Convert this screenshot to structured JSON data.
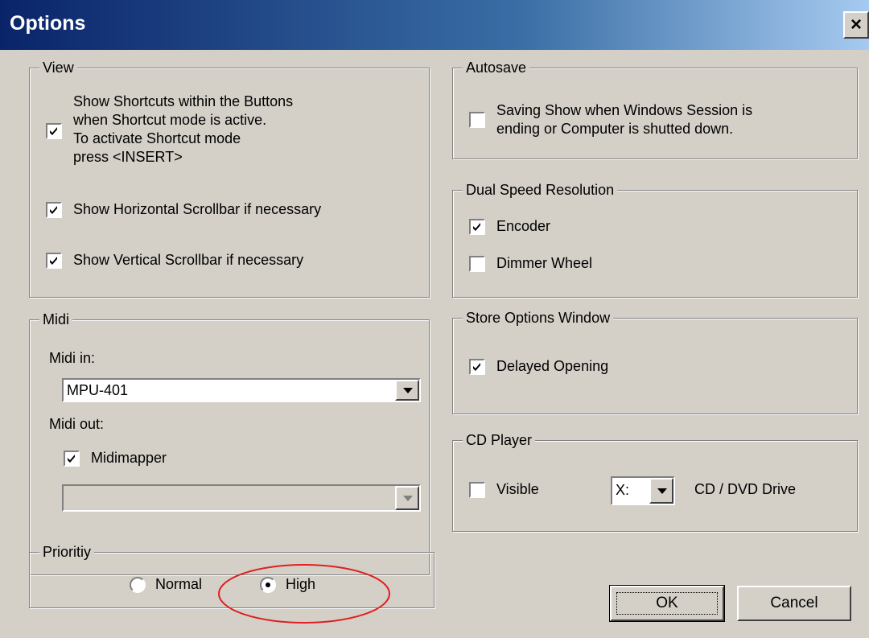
{
  "window": {
    "title": "Options",
    "close_label": "×"
  },
  "view": {
    "legend": "View",
    "shortcuts": {
      "checked": true,
      "lines": [
        "Show Shortcuts within the Buttons",
        "when Shortcut mode is active.",
        "To activate Shortcut mode",
        "press <INSERT>"
      ]
    },
    "horizontal": {
      "checked": true,
      "label": "Show Horizontal Scrollbar if necessary"
    },
    "vertical": {
      "checked": true,
      "label": "Show Vertical Scrollbar if necessary"
    }
  },
  "midi": {
    "legend": "Midi",
    "in_label": "Midi in:",
    "in_value": "MPU-401",
    "out_label": "Midi out:",
    "midimapper": {
      "checked": true,
      "label": "Midimapper"
    },
    "out_value": ""
  },
  "priority": {
    "legend": "Prioritiy",
    "normal_label": "Normal",
    "high_label": "High",
    "selected": "High",
    "highlight_color": "#e02020"
  },
  "autosave": {
    "legend": "Autosave",
    "option": {
      "checked": false,
      "lines": [
        "Saving Show when Windows Session is",
        "ending or Computer is shutted down."
      ]
    }
  },
  "dual_speed": {
    "legend": "Dual Speed Resolution",
    "encoder": {
      "checked": true,
      "label": "Encoder"
    },
    "dimmer": {
      "checked": false,
      "label": "Dimmer Wheel"
    }
  },
  "store_options": {
    "legend": "Store Options Window",
    "delayed": {
      "checked": true,
      "label": "Delayed Opening"
    }
  },
  "cd_player": {
    "legend": "CD Player",
    "visible": {
      "checked": false,
      "label": "Visible"
    },
    "drive_value": "X:",
    "drive_label": "CD / DVD Drive"
  },
  "buttons": {
    "ok": "OK",
    "cancel": "Cancel"
  }
}
